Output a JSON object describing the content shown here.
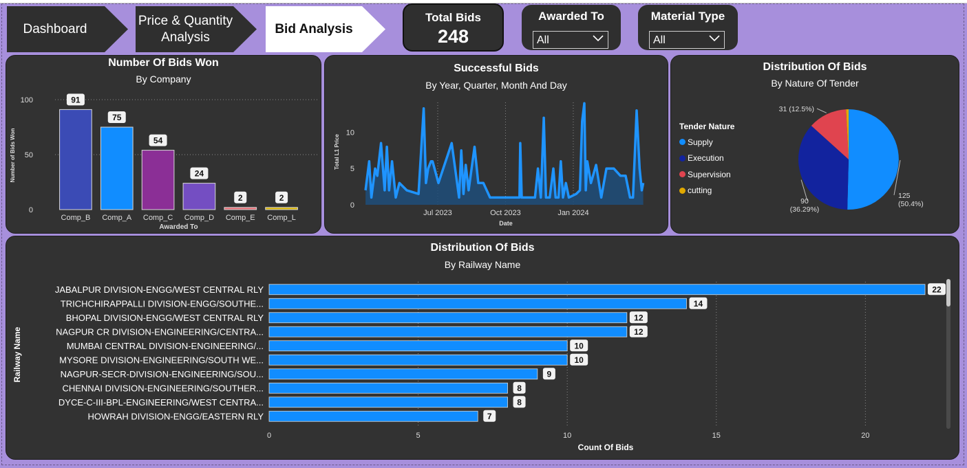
{
  "nav": {
    "dashboard": "Dashboard",
    "price_quantity_line1": "Price & Quantity",
    "price_quantity_line2": "Analysis",
    "bid_analysis": "Bid Analysis"
  },
  "kpi": {
    "label": "Total Bids",
    "value": "248"
  },
  "slicers": [
    {
      "label": "Awarded To",
      "value": "All"
    },
    {
      "label": "Material Type",
      "value": "All"
    }
  ],
  "colors": {
    "supply": "#118dff",
    "execution": "#12239e",
    "supervision": "#e0444f",
    "cutting": "#e1a800",
    "line": "#1f94ff"
  },
  "chart_data": [
    {
      "type": "bar",
      "title": "Number Of Bids Won",
      "subtitle": "By Company",
      "xlabel": "Awarded To",
      "ylabel": "Number of Bids Won",
      "categories": [
        "Comp_B",
        "Comp_A",
        "Comp_C",
        "Comp_D",
        "Comp_E",
        "Comp_L"
      ],
      "values": [
        91,
        75,
        54,
        24,
        2,
        2
      ],
      "bar_colors": [
        "#3b4bb5",
        "#118dff",
        "#8b2f96",
        "#744ec2",
        "#e66c74",
        "#d9b300"
      ],
      "yticks": [
        0,
        50,
        100
      ],
      "ylim": [
        0,
        100
      ]
    },
    {
      "type": "area",
      "title": "Successful Bids",
      "subtitle": "By Year, Quarter, Month And Day",
      "xlabel": "Date",
      "ylabel": "Total L1 Price",
      "xticks": [
        "Jul 2023",
        "Oct 2023",
        "Jan 2024"
      ],
      "yticks": [
        0,
        5,
        10
      ],
      "ylim": [
        0,
        14.5
      ],
      "xlim": [
        "2023-03-24",
        "2024-04-10"
      ],
      "x": [
        "2023-03-25",
        "2023-03-30",
        "2023-04-02",
        "2023-04-07",
        "2023-04-10",
        "2023-04-15",
        "2023-04-20",
        "2023-04-23",
        "2023-04-26",
        "2023-04-30",
        "2023-05-05",
        "2023-05-10",
        "2023-05-15",
        "2023-05-20",
        "2023-06-05",
        "2023-06-12",
        "2023-06-15",
        "2023-06-18",
        "2023-06-22",
        "2023-06-24",
        "2023-07-02",
        "2023-07-20",
        "2023-07-30",
        "2023-08-02",
        "2023-08-05",
        "2023-08-08",
        "2023-08-12",
        "2023-08-20",
        "2023-08-25",
        "2023-09-01",
        "2023-09-10",
        "2023-09-15",
        "2023-09-23",
        "2023-10-05",
        "2023-10-15",
        "2023-10-20",
        "2023-10-21",
        "2023-10-23",
        "2023-11-01",
        "2023-11-10",
        "2023-11-14",
        "2023-11-18",
        "2023-11-22",
        "2023-11-25",
        "2023-11-30",
        "2023-12-05",
        "2023-12-08",
        "2023-12-12",
        "2023-12-15",
        "2023-12-18",
        "2023-12-22",
        "2023-12-26",
        "2024-01-05",
        "2024-01-10",
        "2024-01-13",
        "2024-01-16",
        "2024-01-18",
        "2024-01-20",
        "2024-01-25",
        "2024-02-01",
        "2024-02-08",
        "2024-02-15",
        "2024-02-20",
        "2024-02-25",
        "2024-03-05",
        "2024-03-12",
        "2024-03-18",
        "2024-03-22",
        "2024-03-27",
        "2024-03-31",
        "2024-04-03",
        "2024-04-05"
      ],
      "y": [
        2,
        6,
        1,
        5,
        4,
        8.5,
        2,
        8,
        2,
        6,
        1,
        3,
        2.5,
        2,
        1.5,
        13.3,
        3,
        5,
        6,
        6,
        3,
        8.5,
        1,
        7.5,
        1.5,
        5.5,
        2,
        8,
        3,
        3,
        1,
        1,
        1,
        1,
        1,
        1,
        8.5,
        1,
        1,
        1,
        5,
        1,
        12,
        1,
        1,
        5,
        1,
        1,
        6,
        1,
        3,
        1,
        1.5,
        2,
        11.5,
        14,
        2,
        6,
        3,
        5.5,
        1,
        5,
        5,
        5,
        4,
        4,
        1,
        1,
        13,
        5,
        2,
        3
      ]
    },
    {
      "type": "pie",
      "title": "Distribution Of Bids",
      "subtitle": "By Nature Of Tender",
      "legend_title": "Tender Nature",
      "labels": [
        "Supply",
        "Execution",
        "Supervision",
        "cutting"
      ],
      "values": [
        125,
        90,
        31,
        2
      ],
      "percent_labels": [
        "125\n(50.4%)",
        "90\n(36.29%)",
        "31 (12.5%)",
        ""
      ],
      "colors": [
        "#118dff",
        "#12239e",
        "#e0444f",
        "#e1a800"
      ]
    },
    {
      "type": "bar",
      "orientation": "horizontal",
      "title": "Distribution Of Bids",
      "subtitle": "By Railway Name",
      "xlabel": "Count Of Bids",
      "ylabel": "Railway Name",
      "categories": [
        "JABALPUR DIVISION-ENGG/WEST CENTRAL RLY",
        "TRICHCHIRAPPALLI DIVISION-ENGG/SOUTHE...",
        "BHOPAL DIVISION-ENGG/WEST CENTRAL RLY",
        "NAGPUR CR DIVISION-ENGINEERING/CENTRA...",
        "MUMBAI CENTRAL DIVISION-ENGINEERING/...",
        "MYSORE DIVISION-ENGINEERING/SOUTH WE...",
        "NAGPUR-SECR-DIVISION-ENGINEERING/SOU...",
        "CHENNAI DIVISION-ENGINEERING/SOUTHER...",
        "DYCE-C-III-BPL-ENGINEERING/WEST CENTRA...",
        "HOWRAH DIVISION-ENGG/EASTERN RLY"
      ],
      "values": [
        22,
        14,
        12,
        12,
        10,
        10,
        9,
        8,
        8,
        7
      ],
      "xticks": [
        0,
        5,
        10,
        15,
        20
      ],
      "xlim": [
        0,
        22.6
      ]
    }
  ]
}
